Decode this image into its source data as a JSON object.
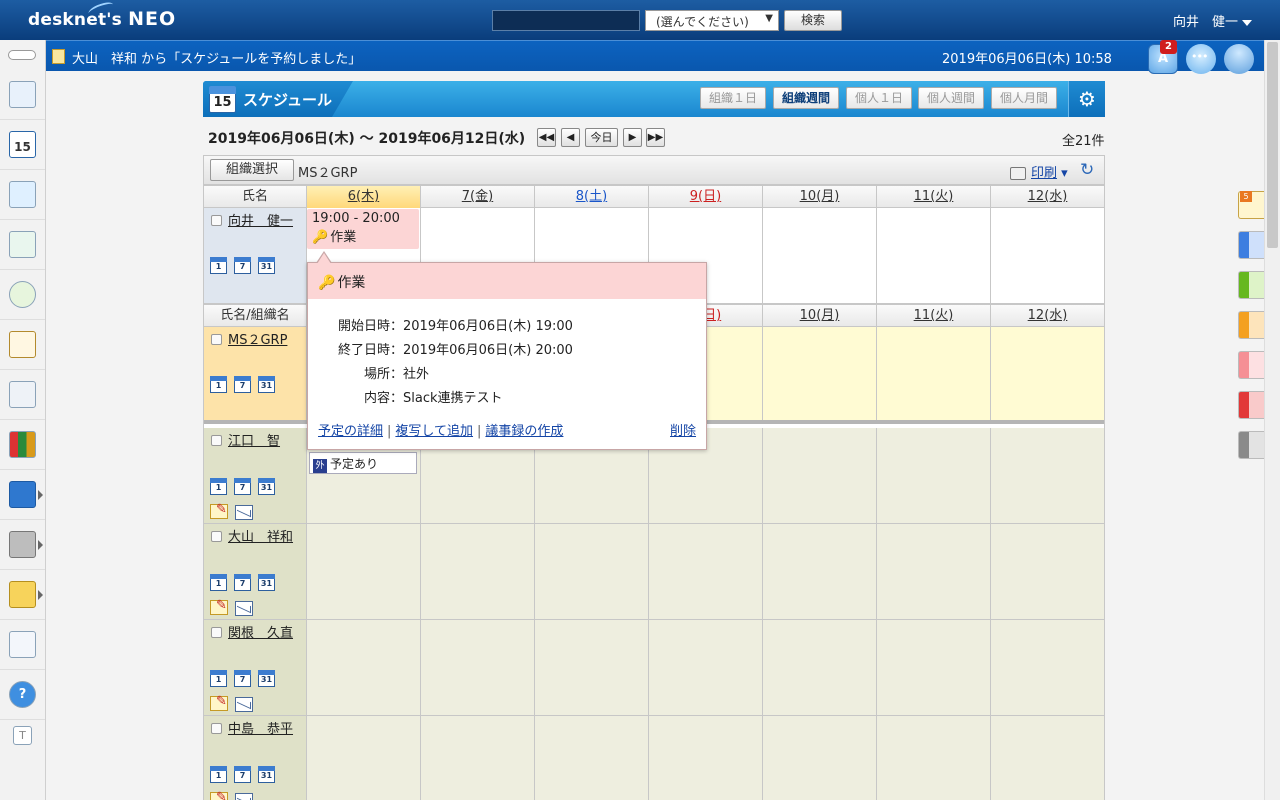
{
  "header": {
    "logo": "desknet's",
    "logo_suffix": "NEO",
    "search_select": "(選んでください)",
    "search_button": "検索",
    "user_name": "向井　健一"
  },
  "notice": {
    "text": "大山　祥和 から「スケジュールを予約しました」",
    "datetime": "2019年06月06日(木) 10:58",
    "badge_count": "2"
  },
  "schedule": {
    "title": "スケジュール",
    "cal_day": "15",
    "views": [
      {
        "label": "組織１日",
        "active": false
      },
      {
        "label": "組織週間",
        "active": true
      },
      {
        "label": "個人１日",
        "active": false
      },
      {
        "label": "個人週間",
        "active": false
      },
      {
        "label": "個人月間",
        "active": false
      }
    ],
    "range": "2019年06月06日(木) ～ 2019年06月12日(水)",
    "today_button": "今日",
    "total": "全21件",
    "org_select_button": "組織選択",
    "org_name": "MS２GRP",
    "print_label": "印刷",
    "name_header": "氏名",
    "name_org_header": "氏名/組織名",
    "days": [
      "6(木)",
      "7(金)",
      "8(土)",
      "9(日)",
      "10(月)",
      "11(火)",
      "12(水)"
    ],
    "right_tab_badge": "5"
  },
  "rows": {
    "self": {
      "name": "向井　健一",
      "event_time": "19:00 - 20:00",
      "event_title": "作業"
    },
    "group": {
      "name": "MS２GRP"
    },
    "members": [
      {
        "name": "江口　智",
        "busy": "予定あり",
        "busy_tag": "外"
      },
      {
        "name": "大山　祥和"
      },
      {
        "name": "関根　久直"
      },
      {
        "name": "中島　恭平"
      }
    ]
  },
  "mini_icons": [
    "1",
    "7",
    "31"
  ],
  "popup": {
    "title": "作業",
    "fields": [
      {
        "label": "開始日時",
        "value": "：2019年06月06日(木) 19:00"
      },
      {
        "label": "終了日時",
        "value": "：2019年06月06日(木) 20:00"
      },
      {
        "label": "場所",
        "value": "：社外"
      },
      {
        "label": "内容",
        "value": "：Slack連携テスト"
      }
    ],
    "links": {
      "detail": "予定の詳細",
      "copy": "複写して追加",
      "minutes": "議事録の作成",
      "delete": "削除"
    }
  }
}
